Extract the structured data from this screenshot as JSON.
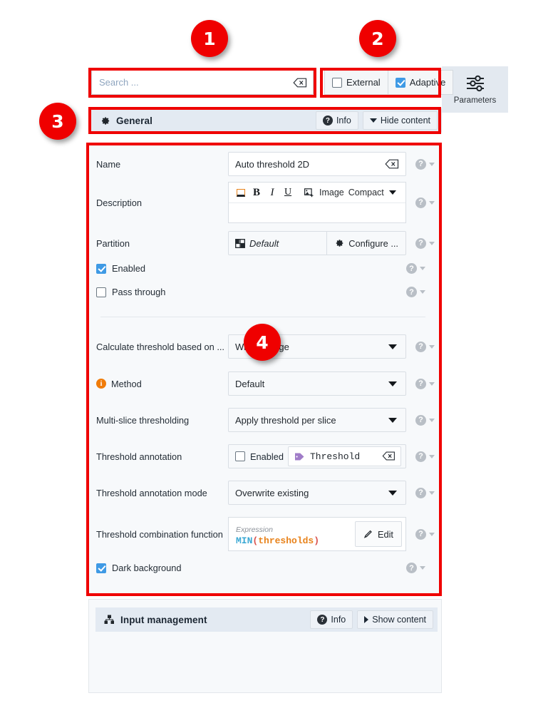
{
  "app": {
    "tab": {
      "label": "Parameters",
      "icon": "sliders-icon"
    }
  },
  "search": {
    "placeholder": "Search ...",
    "value": "",
    "clear_icon": "clear-backspace-icon"
  },
  "toggles": [
    {
      "label": "External",
      "checked": false
    },
    {
      "label": "Adaptive",
      "checked": true
    }
  ],
  "sections": [
    {
      "title": "General",
      "icon": "gear-icon",
      "info_label": "Info",
      "toggle_label": "Hide content",
      "expanded": true
    },
    {
      "title": "Input management",
      "icon": "nodes-icon",
      "info_label": "Info",
      "toggle_label": "Show content",
      "expanded": false
    }
  ],
  "fields": {
    "name": {
      "label": "Name",
      "value": "Auto threshold 2D",
      "clear_icon": "clear-backspace-icon"
    },
    "description": {
      "label": "Description",
      "value": "",
      "toolbar": {
        "color_icon": "text-color-icon",
        "bold": "B",
        "italic": "I",
        "underline": "U",
        "image_icon": "insert-image-icon",
        "image_label": "Image",
        "mode_label": "Compact"
      }
    },
    "partition": {
      "label": "Partition",
      "value": "Default",
      "value_icon": "partition-grid-icon",
      "button_label": "Configure ...",
      "button_icon": "gear-icon"
    },
    "enabled": {
      "label": "Enabled",
      "checked": true
    },
    "pass_through": {
      "label": "Pass through",
      "checked": false
    },
    "calculate_threshold": {
      "label": "Calculate threshold based on ...",
      "value": "Whole image"
    },
    "method": {
      "label": "Method",
      "value": "Default",
      "badge_icon": "info-orange-icon"
    },
    "multi_slice": {
      "label": "Multi-slice thresholding",
      "value": "Apply threshold per slice"
    },
    "threshold_annotation": {
      "label": "Threshold annotation",
      "checkbox_label": "Enabled",
      "checked": false,
      "tag_icon": "tag-icon",
      "value": "Threshold",
      "clear_icon": "clear-backspace-icon"
    },
    "threshold_annotation_mode": {
      "label": "Threshold annotation mode",
      "value": "Overwrite existing"
    },
    "threshold_combination": {
      "label": "Threshold combination function",
      "expression_label": "Expression",
      "expr_function": "MIN",
      "expr_open": "(",
      "expr_argument": "thresholds",
      "expr_close": ")",
      "edit_label": "Edit",
      "edit_icon": "pencil-icon"
    },
    "dark_background": {
      "label": "Dark background",
      "checked": true
    }
  },
  "help_icon": {
    "glyph": "?",
    "name": "help-icon"
  },
  "annotations": {
    "badges": [
      "1",
      "2",
      "3",
      "4"
    ],
    "color": "#ef0000"
  }
}
